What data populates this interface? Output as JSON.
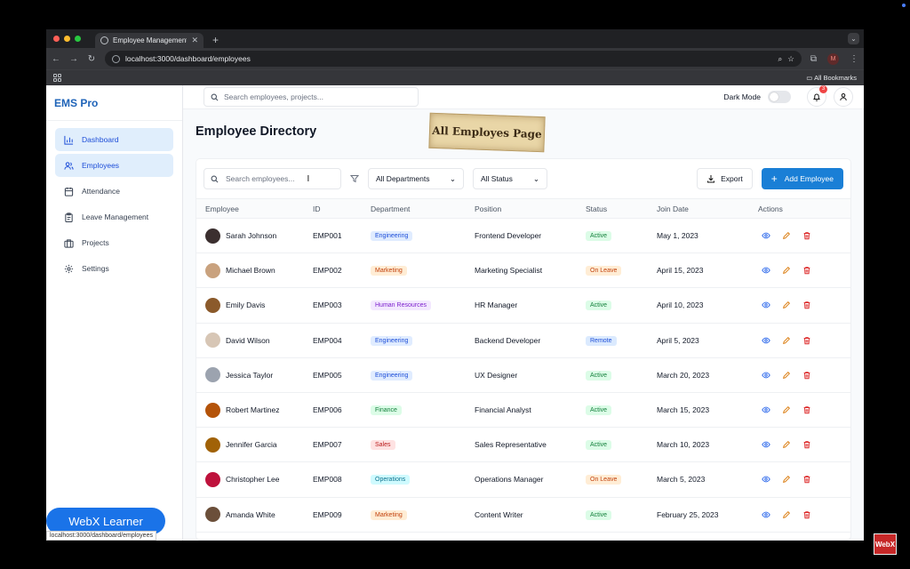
{
  "browser": {
    "tab_title": "Employee Management Syste",
    "url": "localhost:3000/dashboard/employees",
    "profile_initial": "M",
    "bookmarks_label": "All Bookmarks"
  },
  "sidebar": {
    "brand": "EMS Pro",
    "items": [
      {
        "label": "Dashboard",
        "icon": "bar-chart-icon"
      },
      {
        "label": "Employees",
        "icon": "users-icon"
      },
      {
        "label": "Attendance",
        "icon": "calendar-icon"
      },
      {
        "label": "Leave Management",
        "icon": "clipboard-icon"
      },
      {
        "label": "Projects",
        "icon": "briefcase-icon"
      },
      {
        "label": "Settings",
        "icon": "gear-icon"
      }
    ]
  },
  "topbar": {
    "search_placeholder": "Search employees, projects...",
    "dark_mode_label": "Dark Mode",
    "notification_count": "3"
  },
  "page": {
    "title": "Employee Directory",
    "stamp_text": "All Employes Page"
  },
  "filters": {
    "search_placeholder": "Search employees...",
    "department": "All Departments",
    "status": "All Status",
    "export_label": "Export",
    "add_label": "Add Employee"
  },
  "table": {
    "headers": [
      "Employee",
      "ID",
      "Department",
      "Position",
      "Status",
      "Join Date",
      "Actions"
    ],
    "rows": [
      {
        "name": "Sarah Johnson",
        "id": "EMP001",
        "dept": "Engineering",
        "position": "Frontend Developer",
        "status": "Active",
        "join": "May 1, 2023"
      },
      {
        "name": "Michael Brown",
        "id": "EMP002",
        "dept": "Marketing",
        "position": "Marketing Specialist",
        "status": "On Leave",
        "join": "April 15, 2023"
      },
      {
        "name": "Emily Davis",
        "id": "EMP003",
        "dept": "Human Resources",
        "position": "HR Manager",
        "status": "Active",
        "join": "April 10, 2023"
      },
      {
        "name": "David Wilson",
        "id": "EMP004",
        "dept": "Engineering",
        "position": "Backend Developer",
        "status": "Remote",
        "join": "April 5, 2023"
      },
      {
        "name": "Jessica Taylor",
        "id": "EMP005",
        "dept": "Engineering",
        "position": "UX Designer",
        "status": "Active",
        "join": "March 20, 2023"
      },
      {
        "name": "Robert Martinez",
        "id": "EMP006",
        "dept": "Finance",
        "position": "Financial Analyst",
        "status": "Active",
        "join": "March 15, 2023"
      },
      {
        "name": "Jennifer Garcia",
        "id": "EMP007",
        "dept": "Sales",
        "position": "Sales Representative",
        "status": "Active",
        "join": "March 10, 2023"
      },
      {
        "name": "Christopher Lee",
        "id": "EMP008",
        "dept": "Operations",
        "position": "Operations Manager",
        "status": "On Leave",
        "join": "March 5, 2023"
      },
      {
        "name": "Amanda White",
        "id": "EMP009",
        "dept": "Marketing",
        "position": "Content Writer",
        "status": "Active",
        "join": "February 25, 2023"
      }
    ]
  },
  "colors": {
    "accent": "#1a7fd6",
    "dept": {
      "Engineering": [
        "#e0ecff",
        "#1d4ed8"
      ],
      "Marketing": [
        "#ffedd5",
        "#c2410c"
      ],
      "Human Resources": [
        "#f3e8ff",
        "#7e22ce"
      ],
      "Finance": [
        "#dcfce7",
        "#15803d"
      ],
      "Sales": [
        "#fee2e2",
        "#b91c1c"
      ],
      "Operations": [
        "#cffafe",
        "#0e7490"
      ]
    },
    "status": {
      "Active": [
        "#dcfce7",
        "#15803d"
      ],
      "On Leave": [
        "#ffedd5",
        "#c2410c"
      ],
      "Remote": [
        "#dbeafe",
        "#1d4ed8"
      ]
    },
    "avatars": [
      "#3b2f2f",
      "#c9a27e",
      "#8b5a2b",
      "#d7c6b5",
      "#9ca3af",
      "#b45309",
      "#a16207",
      "#be123c",
      "#6b4f3a"
    ]
  },
  "overlay": {
    "watermark": "WebX Learner",
    "status_url": "localhost:3000/dashboard/employees",
    "logo_text": "WebX"
  }
}
